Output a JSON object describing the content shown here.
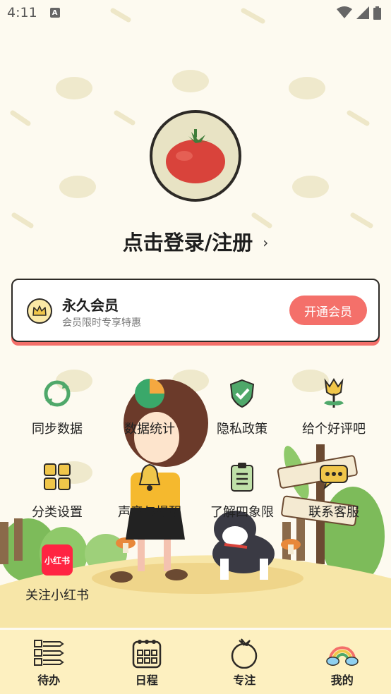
{
  "status": {
    "time": "4:11",
    "notif_letter": "A"
  },
  "login": {
    "text": "点击登录/注册",
    "chevron": "›"
  },
  "vip": {
    "title": "永久会员",
    "subtitle": "会员限时专享特惠",
    "button": "开通会员",
    "accent": "#f4706a"
  },
  "grid": {
    "items": [
      {
        "label": "同步数据",
        "icon": "sync-icon"
      },
      {
        "label": "数据统计",
        "icon": "pie-chart-icon"
      },
      {
        "label": "隐私政策",
        "icon": "shield-check-icon"
      },
      {
        "label": "给个好评吧",
        "icon": "tulip-icon"
      },
      {
        "label": "分类设置",
        "icon": "category-grid-icon"
      },
      {
        "label": "声音与提醒",
        "icon": "bell-icon"
      },
      {
        "label": "了解四象限",
        "icon": "clipboard-icon"
      },
      {
        "label": "联系客服",
        "icon": "chat-bubble-icon"
      },
      {
        "label": "关注小红书",
        "icon": "xiaohongshu-icon",
        "badge": "小红书"
      }
    ]
  },
  "tabs": [
    {
      "label": "待办",
      "icon": "list-icon"
    },
    {
      "label": "日程",
      "icon": "calendar-icon"
    },
    {
      "label": "专注",
      "icon": "tomato-icon"
    },
    {
      "label": "我的",
      "icon": "rainbow-icon"
    }
  ]
}
